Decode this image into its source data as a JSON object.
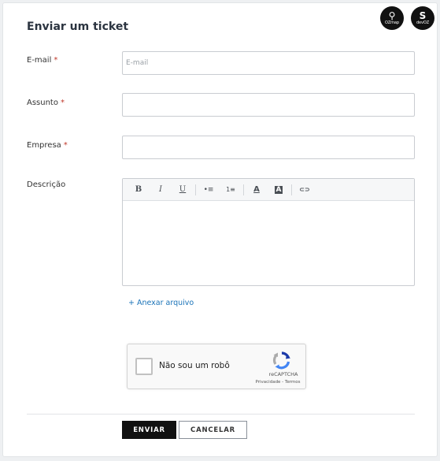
{
  "form": {
    "title": "Enviar um ticket",
    "required_marker": "*",
    "email": {
      "label": "E-mail",
      "placeholder": "E-mail",
      "value": ""
    },
    "subject": {
      "label": "Assunto",
      "value": ""
    },
    "company": {
      "label": "Empresa",
      "value": ""
    },
    "description": {
      "label": "Descrição",
      "value": ""
    },
    "attach_label": "+ Anexar arquivo"
  },
  "logos": {
    "ozmap": {
      "mark": "⚲",
      "text": "OZmap",
      "icon": "map-pin-icon"
    },
    "devoz": {
      "mark": "S",
      "text": "devOZ",
      "icon": "devoz-logo-icon"
    }
  },
  "editor_toolbar": {
    "buttons": [
      {
        "name": "bold",
        "glyph": "B"
      },
      {
        "name": "italic",
        "glyph": "I"
      },
      {
        "name": "underline",
        "glyph": "U"
      },
      {
        "name": "bulleted-list",
        "glyph": "•≡"
      },
      {
        "name": "numbered-list",
        "glyph": "1≡"
      },
      {
        "name": "text-color",
        "glyph": "A"
      },
      {
        "name": "background-color",
        "glyph": "A"
      },
      {
        "name": "link",
        "glyph": "⊂⊃"
      }
    ]
  },
  "recaptcha": {
    "label": "Não sou um robô",
    "brand": "reCAPTCHA",
    "links": "Privacidade - Termos",
    "checked": false
  },
  "actions": {
    "submit_label": "ENVIAR",
    "cancel_label": "CANCELAR"
  },
  "colors": {
    "required": "#c0392b",
    "link": "#1a73b8",
    "primary_button": "#111111"
  }
}
